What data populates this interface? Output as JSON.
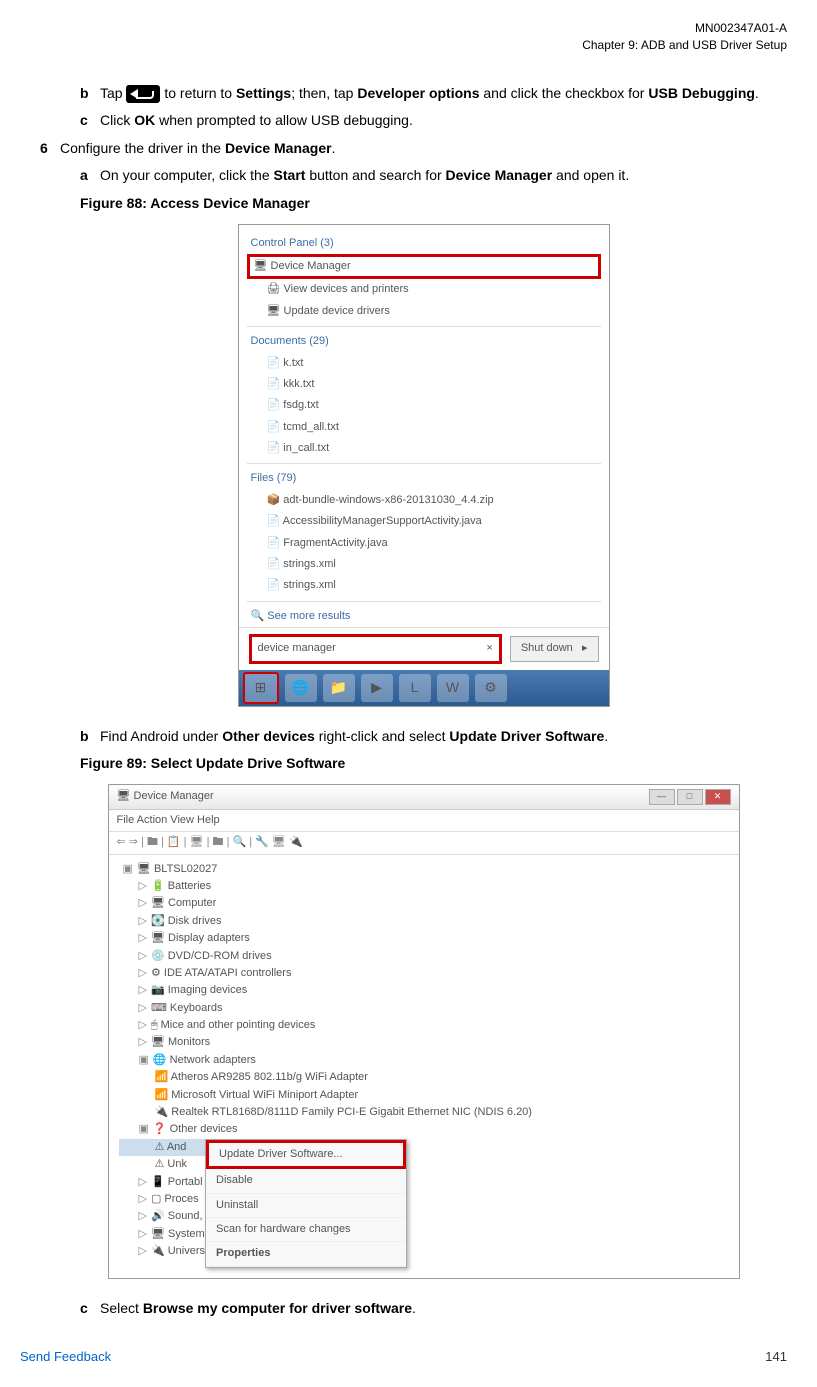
{
  "header": {
    "doc_id": "MN002347A01-A",
    "chapter": "Chapter 9:  ADB and USB Driver Setup"
  },
  "steps": {
    "b1_pre": "Tap ",
    "b1_mid": " to return to ",
    "b1_settings": "Settings",
    "b1_then": "; then, tap ",
    "b1_dev": "Developer options",
    "b1_click": " and click the checkbox for ",
    "b1_usb": "USB Debugging",
    "b1_end": ".",
    "c1_pre": "Click ",
    "c1_ok": "OK",
    "c1_post": " when prompted to allow USB debugging.",
    "s6_pre": "Configure the driver in the ",
    "s6_dm": "Device Manager",
    "s6_end": ".",
    "a2_pre": "On your computer, click the ",
    "a2_start": "Start",
    "a2_mid": " button and search for ",
    "a2_dm": "Device Manager",
    "a2_end": " and open it.",
    "fig88": "Figure 88: Access Device Manager",
    "b2_pre": "Find Android under ",
    "b2_od": "Other devices",
    "b2_mid": " right-click and select ",
    "b2_uds": "Update Driver Software",
    "b2_end": ".",
    "fig89": "Figure 89: Select Update Drive Software",
    "c2_pre": "Select ",
    "c2_browse": "Browse my computer for driver software",
    "c2_end": "."
  },
  "letters": {
    "b": "b",
    "c": "c",
    "a": "a",
    "six": "6"
  },
  "ss1": {
    "cp": "Control Panel (3)",
    "dm": "Device Manager",
    "vdp": "View devices and printers",
    "udd": "Update device drivers",
    "docs": "Documents (29)",
    "d1": "k.txt",
    "d2": "kkk.txt",
    "d3": "fsdg.txt",
    "d4": "tcmd_all.txt",
    "d5": "in_call.txt",
    "files": "Files (79)",
    "f1": "adt-bundle-windows-x86-20131030_4.4.zip",
    "f2": "AccessibilityManagerSupportActivity.java",
    "f3": "FragmentActivity.java",
    "f4": "strings.xml",
    "f5": "strings.xml",
    "more": "See more results",
    "search": "device manager",
    "x": "×",
    "shutdown": "Shut down",
    "arrow": "▸"
  },
  "ss2": {
    "title": "Device Manager",
    "menu": "File    Action    View    Help",
    "toolbar": "⇐ ⇒ | 🖿 | 📋 | 🖥 | 🖿 | 🔍 | 🔧 🖥 🔌",
    "root": "BLTSL02027",
    "t1": "Batteries",
    "t2": "Computer",
    "t3": "Disk drives",
    "t4": "Display adapters",
    "t5": "DVD/CD-ROM drives",
    "t6": "IDE ATA/ATAPI controllers",
    "t7": "Imaging devices",
    "t8": "Keyboards",
    "t9": "Mice and other pointing devices",
    "t10": "Monitors",
    "t11": "Network adapters",
    "t11a": "Atheros AR9285 802.11b/g WiFi Adapter",
    "t11b": "Microsoft Virtual WiFi Miniport Adapter",
    "t11c": "Realtek RTL8168D/8111D Family PCI-E Gigabit Ethernet NIC (NDIS 6.20)",
    "t12": "Other devices",
    "t12a": "And",
    "t12b": "Unk",
    "t13": "Portabl",
    "t14": "Proces",
    "t15": "Sound,",
    "t16": "System",
    "t17": "Univers",
    "ctx1": "Update Driver Software...",
    "ctx2": "Disable",
    "ctx3": "Uninstall",
    "ctx4": "Scan for hardware changes",
    "ctx5": "Properties"
  },
  "footer": {
    "feedback": "Send Feedback",
    "page": "141"
  }
}
